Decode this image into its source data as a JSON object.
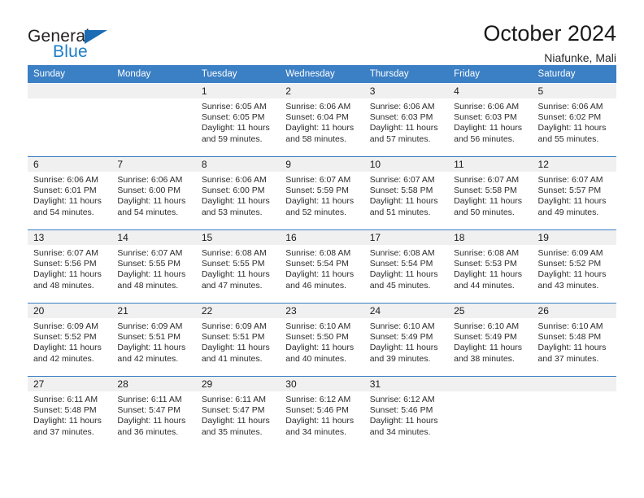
{
  "brand": {
    "name_part1": "General",
    "name_part2": "Blue",
    "triangle_color": "#1b6cb5",
    "blue_color": "#1b7ec9"
  },
  "header": {
    "title": "October 2024",
    "subtitle": "Niafunke, Mali"
  },
  "theme": {
    "header_blue": "#3b7fc4",
    "daynum_band": "#f0f0f0",
    "text": "#2b2b2b"
  },
  "weekday_headers": [
    "Sunday",
    "Monday",
    "Tuesday",
    "Wednesday",
    "Thursday",
    "Friday",
    "Saturday"
  ],
  "weeks": [
    [
      {
        "day": "",
        "sunrise": "",
        "sunset": "",
        "daylight": "",
        "empty": true
      },
      {
        "day": "",
        "sunrise": "",
        "sunset": "",
        "daylight": "",
        "empty": true
      },
      {
        "day": "1",
        "sunrise": "Sunrise: 6:05 AM",
        "sunset": "Sunset: 6:05 PM",
        "daylight": "Daylight: 11 hours and 59 minutes."
      },
      {
        "day": "2",
        "sunrise": "Sunrise: 6:06 AM",
        "sunset": "Sunset: 6:04 PM",
        "daylight": "Daylight: 11 hours and 58 minutes."
      },
      {
        "day": "3",
        "sunrise": "Sunrise: 6:06 AM",
        "sunset": "Sunset: 6:03 PM",
        "daylight": "Daylight: 11 hours and 57 minutes."
      },
      {
        "day": "4",
        "sunrise": "Sunrise: 6:06 AM",
        "sunset": "Sunset: 6:03 PM",
        "daylight": "Daylight: 11 hours and 56 minutes."
      },
      {
        "day": "5",
        "sunrise": "Sunrise: 6:06 AM",
        "sunset": "Sunset: 6:02 PM",
        "daylight": "Daylight: 11 hours and 55 minutes."
      }
    ],
    [
      {
        "day": "6",
        "sunrise": "Sunrise: 6:06 AM",
        "sunset": "Sunset: 6:01 PM",
        "daylight": "Daylight: 11 hours and 54 minutes."
      },
      {
        "day": "7",
        "sunrise": "Sunrise: 6:06 AM",
        "sunset": "Sunset: 6:00 PM",
        "daylight": "Daylight: 11 hours and 54 minutes."
      },
      {
        "day": "8",
        "sunrise": "Sunrise: 6:06 AM",
        "sunset": "Sunset: 6:00 PM",
        "daylight": "Daylight: 11 hours and 53 minutes."
      },
      {
        "day": "9",
        "sunrise": "Sunrise: 6:07 AM",
        "sunset": "Sunset: 5:59 PM",
        "daylight": "Daylight: 11 hours and 52 minutes."
      },
      {
        "day": "10",
        "sunrise": "Sunrise: 6:07 AM",
        "sunset": "Sunset: 5:58 PM",
        "daylight": "Daylight: 11 hours and 51 minutes."
      },
      {
        "day": "11",
        "sunrise": "Sunrise: 6:07 AM",
        "sunset": "Sunset: 5:58 PM",
        "daylight": "Daylight: 11 hours and 50 minutes."
      },
      {
        "day": "12",
        "sunrise": "Sunrise: 6:07 AM",
        "sunset": "Sunset: 5:57 PM",
        "daylight": "Daylight: 11 hours and 49 minutes."
      }
    ],
    [
      {
        "day": "13",
        "sunrise": "Sunrise: 6:07 AM",
        "sunset": "Sunset: 5:56 PM",
        "daylight": "Daylight: 11 hours and 48 minutes."
      },
      {
        "day": "14",
        "sunrise": "Sunrise: 6:07 AM",
        "sunset": "Sunset: 5:55 PM",
        "daylight": "Daylight: 11 hours and 48 minutes."
      },
      {
        "day": "15",
        "sunrise": "Sunrise: 6:08 AM",
        "sunset": "Sunset: 5:55 PM",
        "daylight": "Daylight: 11 hours and 47 minutes."
      },
      {
        "day": "16",
        "sunrise": "Sunrise: 6:08 AM",
        "sunset": "Sunset: 5:54 PM",
        "daylight": "Daylight: 11 hours and 46 minutes."
      },
      {
        "day": "17",
        "sunrise": "Sunrise: 6:08 AM",
        "sunset": "Sunset: 5:54 PM",
        "daylight": "Daylight: 11 hours and 45 minutes."
      },
      {
        "day": "18",
        "sunrise": "Sunrise: 6:08 AM",
        "sunset": "Sunset: 5:53 PM",
        "daylight": "Daylight: 11 hours and 44 minutes."
      },
      {
        "day": "19",
        "sunrise": "Sunrise: 6:09 AM",
        "sunset": "Sunset: 5:52 PM",
        "daylight": "Daylight: 11 hours and 43 minutes."
      }
    ],
    [
      {
        "day": "20",
        "sunrise": "Sunrise: 6:09 AM",
        "sunset": "Sunset: 5:52 PM",
        "daylight": "Daylight: 11 hours and 42 minutes."
      },
      {
        "day": "21",
        "sunrise": "Sunrise: 6:09 AM",
        "sunset": "Sunset: 5:51 PM",
        "daylight": "Daylight: 11 hours and 42 minutes."
      },
      {
        "day": "22",
        "sunrise": "Sunrise: 6:09 AM",
        "sunset": "Sunset: 5:51 PM",
        "daylight": "Daylight: 11 hours and 41 minutes."
      },
      {
        "day": "23",
        "sunrise": "Sunrise: 6:10 AM",
        "sunset": "Sunset: 5:50 PM",
        "daylight": "Daylight: 11 hours and 40 minutes."
      },
      {
        "day": "24",
        "sunrise": "Sunrise: 6:10 AM",
        "sunset": "Sunset: 5:49 PM",
        "daylight": "Daylight: 11 hours and 39 minutes."
      },
      {
        "day": "25",
        "sunrise": "Sunrise: 6:10 AM",
        "sunset": "Sunset: 5:49 PM",
        "daylight": "Daylight: 11 hours and 38 minutes."
      },
      {
        "day": "26",
        "sunrise": "Sunrise: 6:10 AM",
        "sunset": "Sunset: 5:48 PM",
        "daylight": "Daylight: 11 hours and 37 minutes."
      }
    ],
    [
      {
        "day": "27",
        "sunrise": "Sunrise: 6:11 AM",
        "sunset": "Sunset: 5:48 PM",
        "daylight": "Daylight: 11 hours and 37 minutes."
      },
      {
        "day": "28",
        "sunrise": "Sunrise: 6:11 AM",
        "sunset": "Sunset: 5:47 PM",
        "daylight": "Daylight: 11 hours and 36 minutes."
      },
      {
        "day": "29",
        "sunrise": "Sunrise: 6:11 AM",
        "sunset": "Sunset: 5:47 PM",
        "daylight": "Daylight: 11 hours and 35 minutes."
      },
      {
        "day": "30",
        "sunrise": "Sunrise: 6:12 AM",
        "sunset": "Sunset: 5:46 PM",
        "daylight": "Daylight: 11 hours and 34 minutes."
      },
      {
        "day": "31",
        "sunrise": "Sunrise: 6:12 AM",
        "sunset": "Sunset: 5:46 PM",
        "daylight": "Daylight: 11 hours and 34 minutes."
      },
      {
        "day": "",
        "sunrise": "",
        "sunset": "",
        "daylight": "",
        "empty": true
      },
      {
        "day": "",
        "sunrise": "",
        "sunset": "",
        "daylight": "",
        "empty": true
      }
    ]
  ]
}
